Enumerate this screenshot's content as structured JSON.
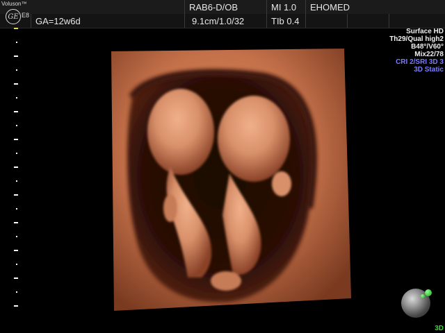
{
  "device": {
    "brand": "Voluson™",
    "logo_text": "GE",
    "model": "E8"
  },
  "header": {
    "row1": {
      "probe": "RAB6-D/OB",
      "mi_label": "MI 1.0",
      "operator": "EHOMED"
    },
    "row2": {
      "gestational_age": "GA=12w6d",
      "depth_info": "9.1cm/1.0/32",
      "tib_label": "TIb 0.4"
    }
  },
  "params": {
    "lines": [
      {
        "text": "Surface  HD",
        "color": "white"
      },
      {
        "text": "Th29/Qual high2",
        "color": "white"
      },
      {
        "text": "B48°/V60°",
        "color": "white"
      },
      {
        "text": "Mix22/78",
        "color": "white"
      },
      {
        "text": "CRI 2/SRI 3D 3",
        "color": "blue"
      },
      {
        "text": "3D Static",
        "color": "blue"
      }
    ]
  },
  "orientation": {
    "mode_label": "3D"
  },
  "colors": {
    "accent_green": "#3fd23f",
    "param_blue": "#7c7cff",
    "tissue": "#c4714a"
  }
}
